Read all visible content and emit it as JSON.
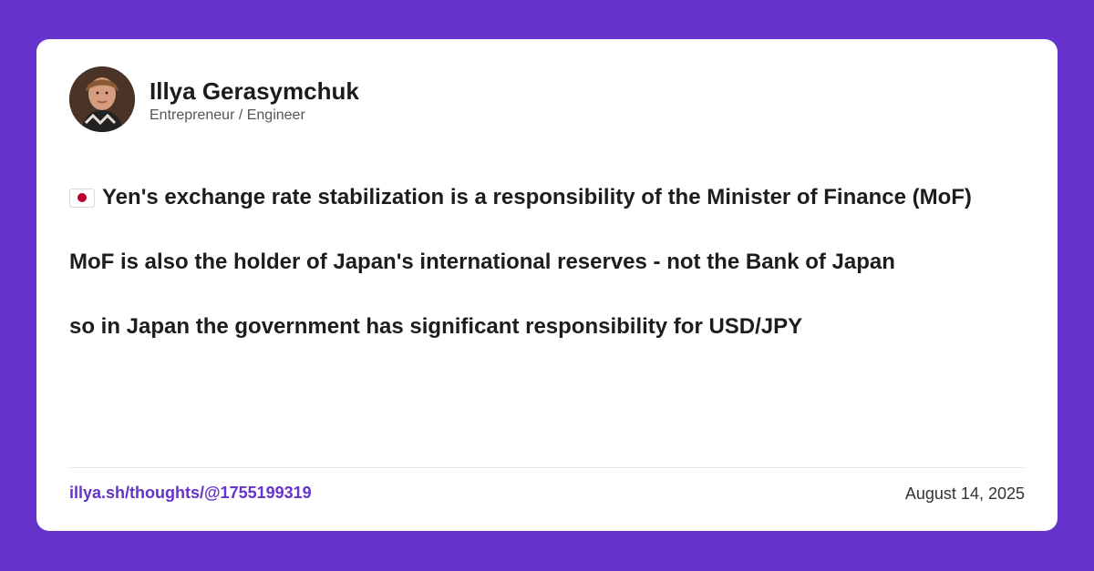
{
  "author": {
    "name": "Illya Gerasymchuk",
    "title": "Entrepreneur / Engineer"
  },
  "post": {
    "flag_icon": "japan-flag-icon",
    "lines": [
      "Yen's exchange rate stabilization is a responsibility of the Minister of Finance (MoF)",
      "MoF is also the holder of Japan's international reserves - not the Bank of Japan",
      "so in Japan the government has significant responsibility for USD/JPY"
    ]
  },
  "footer": {
    "link": "illya.sh/thoughts/@1755199319",
    "date": "August 14, 2025"
  },
  "colors": {
    "background": "#6633cc",
    "card": "#ffffff",
    "accent": "#6633cc"
  }
}
